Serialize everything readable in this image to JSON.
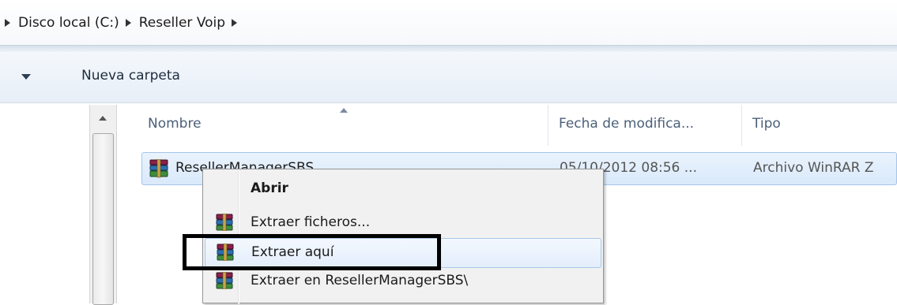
{
  "address_bar": {
    "crumbs": [
      "Disco local (C:)",
      "Reseller Voip"
    ]
  },
  "toolbar": {
    "new_folder_label": "Nueva carpeta"
  },
  "columns": {
    "name": "Nombre",
    "date": "Fecha de modifica...",
    "type": "Tipo"
  },
  "file": {
    "name": "ResellerManagerSBS",
    "date": "05/10/2012 08:56 ...",
    "type": "Archivo WinRAR Z",
    "icon": "winrar-archive-icon"
  },
  "context_menu": {
    "items": [
      {
        "label": "Abrir",
        "icon": ""
      },
      {
        "label": "Extraer ficheros...",
        "icon": "winrar-icon"
      },
      {
        "label": "Extraer aquí",
        "icon": "winrar-icon"
      },
      {
        "label": "Extraer en ResellerManagerSBS\\",
        "icon": "winrar-icon"
      }
    ]
  },
  "colors": {
    "selection": "#d9e9fb",
    "highlight_box": "#000000"
  }
}
